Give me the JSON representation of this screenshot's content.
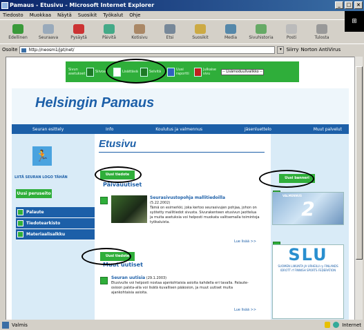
{
  "window": {
    "title": "Pamaus - Etusivu - Microsoft Internet Explorer",
    "controls": [
      "_",
      "□",
      "×"
    ]
  },
  "menu": [
    "Tiedosto",
    "Muokkaa",
    "Näytä",
    "Suosikit",
    "Työkalut",
    "Ohje"
  ],
  "toolbar": [
    {
      "label": "Edellinen",
      "icon": "back-icon"
    },
    {
      "label": "Seuraava",
      "icon": "forward-icon"
    },
    {
      "label": "Pysäytä",
      "icon": "stop-icon"
    },
    {
      "label": "Päivitä",
      "icon": "refresh-icon"
    },
    {
      "label": "Koti­sivu",
      "icon": "home-icon"
    },
    {
      "label": "Etsi",
      "icon": "search-icon"
    },
    {
      "label": "Suosikit",
      "icon": "favorites-icon"
    },
    {
      "label": "Media",
      "icon": "media-icon"
    },
    {
      "label": "Sivuhistoria",
      "icon": "history-icon"
    },
    {
      "label": "Posti",
      "icon": "mail-icon"
    },
    {
      "label": "Tulosta",
      "icon": "print-icon"
    }
  ],
  "address": {
    "label": "Osoite",
    "url": "http://neosm1/jpt/net/",
    "go": "Siirry",
    "links": "Norton AntiVirus"
  },
  "page": {
    "greenbar": [
      {
        "label": "Sivun asetukset"
      },
      {
        "label": "Siivoa"
      },
      {
        "label": "Lisättävä"
      },
      {
        "label": "Selvitä"
      },
      {
        "label": "Uusi raportti"
      },
      {
        "label": "Julkaise sivu"
      }
    ],
    "greenbar_select": "-- Lisämoduulivalikko --",
    "site_title": "Helsingin Pamaus",
    "nav": [
      "Seuran esittely",
      "Info",
      "Koulutus ja valmennus",
      "Jäsenluettelo",
      "Muut palvelut"
    ],
    "sidebar": {
      "tagline": "LIITÄ SEURAN LOGO TÄHÄN",
      "new_button": "Uusi peruseito",
      "links": [
        "Palaute",
        "Tiedotearkisto",
        "Materiaalisalkku"
      ]
    },
    "page_title": "Etusivu",
    "main": {
      "new_news_button": "Uusi tiedote",
      "section_news": "Päiväuutiset",
      "article1": {
        "title": "Seurasivustopohja mallitiedoilla",
        "date": "(5.22.2002)",
        "body": "Tämä on esimerkki, joka kertoo seurasivujen pohjaa, johon on syötetty mallitiedot sivusta. Sivurakenteen etusivun jaottelua ja muita asetuksia voi helposti muokata valitsemalla toimintoja työkaluista."
      },
      "read_more1": "Lue lisää >>",
      "new_news_button2": "Uusi tiedote",
      "section_other": "Muut uutiset",
      "article2": {
        "title": "Seuran uutisia",
        "date": "(29.1.2003)",
        "body": "Etusivulle voi helposti nostaa ajankohtaisia asioita kahdella eri tavalla. Palaute-osioon palsta-alla voi lisätä kuvallisen pääosion, ja muut uutiset muita ajankohtaisia asioita."
      },
      "read_more2": "Lue lisää >>"
    },
    "right": {
      "new_banner_button": "Uusi banneri",
      "banner1_label": "VALMENNUS",
      "banner1_text": "2",
      "slu_big": "SLU",
      "slu_text": "SUOMEN LIIKUNTA JA URHEILU ry FINLANDS IDROTT rf FINNISH SPORTS FEDERATION"
    }
  },
  "status": {
    "text": "Valmis",
    "zone": "Internet"
  }
}
